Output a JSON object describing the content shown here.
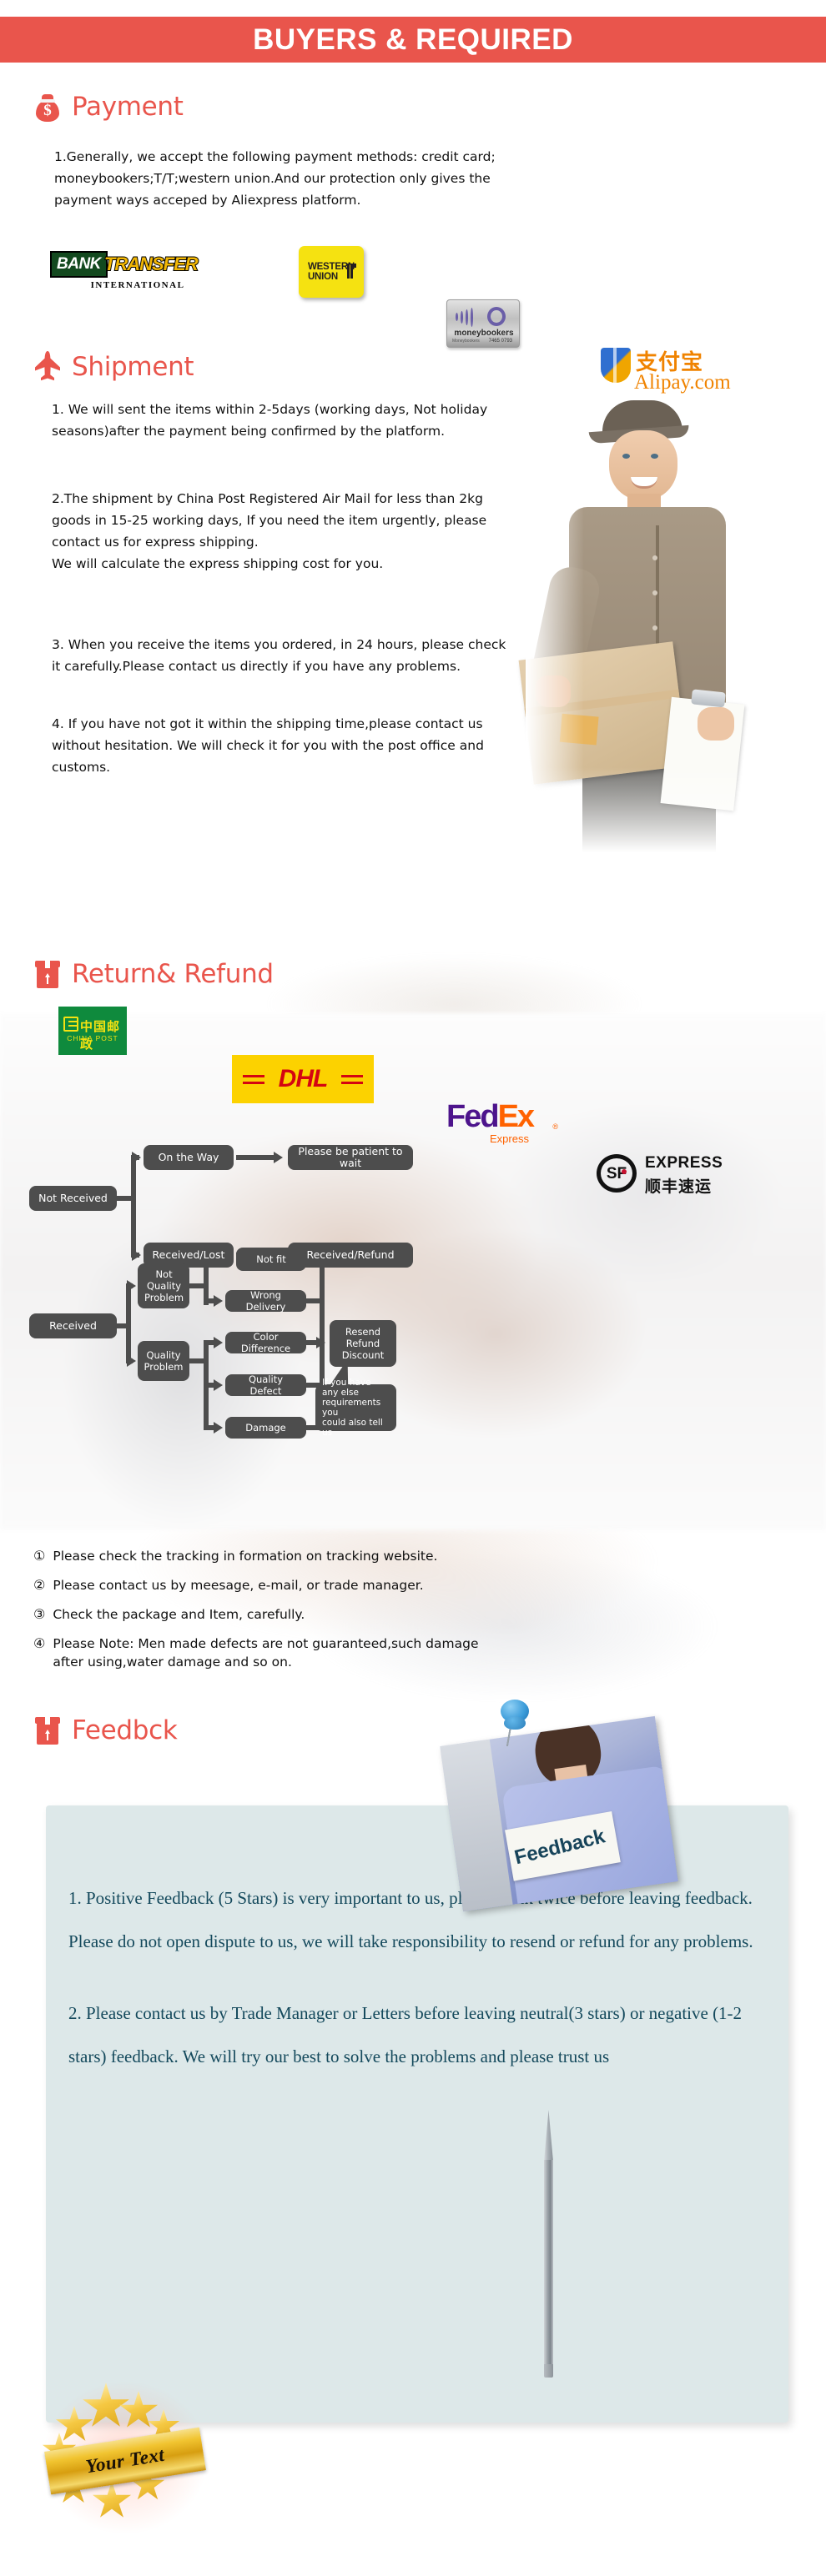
{
  "banner": {
    "title": "BUYERS & REQUIRED"
  },
  "sections": {
    "payment": {
      "title": "Payment",
      "icon": "money-bag-icon",
      "body": "1.Generally, we accept the following payment methods: credit card;\nmoneybookers;T/T;western union.And our protection only gives the\npayment ways acceped by Aliexpress platform.",
      "logos": [
        {
          "name": "bank-transfer-logo",
          "primary": "BANK",
          "secondary": "TRANSFER",
          "sub": "INTERNATIONAL"
        },
        {
          "name": "western-union-logo",
          "line1": "WESTERN",
          "line2": "UNION"
        },
        {
          "name": "moneybookers-logo",
          "label": "moneybookers",
          "tiny_left": "Moneybookers",
          "tiny_right": "7465 0793"
        },
        {
          "name": "alipay-logo",
          "cn": "支付宝",
          "label": "Alipay.com"
        }
      ]
    },
    "shipment": {
      "title": "Shipment",
      "icon": "airplane-icon",
      "paragraphs": [
        "1. We will sent the items within 2-5days (working days, Not holiday\nseasons)after the payment being confirmed by the platform.",
        "2.The shipment by China Post Registered Air Mail for less than  2kg\ngoods in 15-25 working days, If  you need the item urgently, please\ncontact us for express shipping.\nWe will calculate the express shipping cost for you.",
        "3. When you receive the items you ordered, in 24 hours, please check\n it carefully.Please contact us directly if you have any problems.",
        "4. If you have not got it within the shipping time,please contact us\nwithout hesitation. We will check it for you with the post office and\ncustoms."
      ],
      "logos": [
        {
          "name": "china-post-logo",
          "cn": "中国邮政",
          "en": "CHINA POST"
        },
        {
          "name": "dhl-logo",
          "label": "DHL"
        },
        {
          "name": "fedex-logo",
          "part1": "Fed",
          "part2": "Ex",
          "sub": "Express",
          "reg": "®"
        },
        {
          "name": "sf-express-logo",
          "mark": "SF",
          "en": "EXPRESS",
          "cn": "顺丰速运"
        }
      ]
    },
    "return_refund": {
      "title": "Return& Refund",
      "icon": "return-box-icon",
      "flowchart": {
        "nodes": [
          {
            "id": "not-received",
            "label": "Not Received"
          },
          {
            "id": "on-the-way",
            "label": "On the Way"
          },
          {
            "id": "please-wait",
            "label": "Please be patient to wait"
          },
          {
            "id": "received-lost",
            "label": "Received/Lost"
          },
          {
            "id": "received-refund",
            "label": "Received/Refund"
          },
          {
            "id": "received",
            "label": "Received"
          },
          {
            "id": "not-quality-problem",
            "label": "Not\nQuality\nProblem"
          },
          {
            "id": "quality-problem",
            "label": "Quality\nProblem"
          },
          {
            "id": "not-fit",
            "label": "Not fit"
          },
          {
            "id": "wrong-delivery",
            "label": "Wrong Delivery"
          },
          {
            "id": "color-difference",
            "label": "Color Difference"
          },
          {
            "id": "quality-defect",
            "label": "Quality Defect"
          },
          {
            "id": "damage",
            "label": "Damage"
          },
          {
            "id": "resend-refund-discount",
            "label": "Resend\nRefund\nDiscount"
          },
          {
            "id": "else-requirements",
            "label": "If you have any else\nrequirements you\ncould also tell us"
          }
        ]
      },
      "notes": [
        {
          "num": "①",
          "text": "Please check the tracking in formation on tracking website."
        },
        {
          "num": "②",
          "text": "Please contact us by meesage, e-mail, or trade manager."
        },
        {
          "num": "③",
          "text": "Check the package and Item, carefully."
        },
        {
          "num": "④",
          "text": "Please Note: Men made defects  are not guaranteed,such damage\n   after using,water damage and so on."
        }
      ]
    },
    "feedback": {
      "title": "Feedbck",
      "icon": "return-box-icon",
      "photo_sign_text": "Feedback",
      "paragraphs": [
        "1. Positive Feedback (5 Stars) is very important to us, please think twice before leaving feedback. Please do not open dispute to us,   we will take responsibility to resend or refund for any problems.",
        "2. Please contact us by Trade Manager or Letters before leaving neutral(3 stars) or negative (1-2 stars) feedback. We will try our best to solve the problems and please trust us"
      ],
      "badge_text": "Your Text"
    }
  },
  "colors": {
    "banner_red": "#e9554c",
    "heading_red": "#e9554c",
    "flow_node": "#4d4d4d",
    "feedback_box": "#dde8e9",
    "feedback_text": "#14495c"
  }
}
